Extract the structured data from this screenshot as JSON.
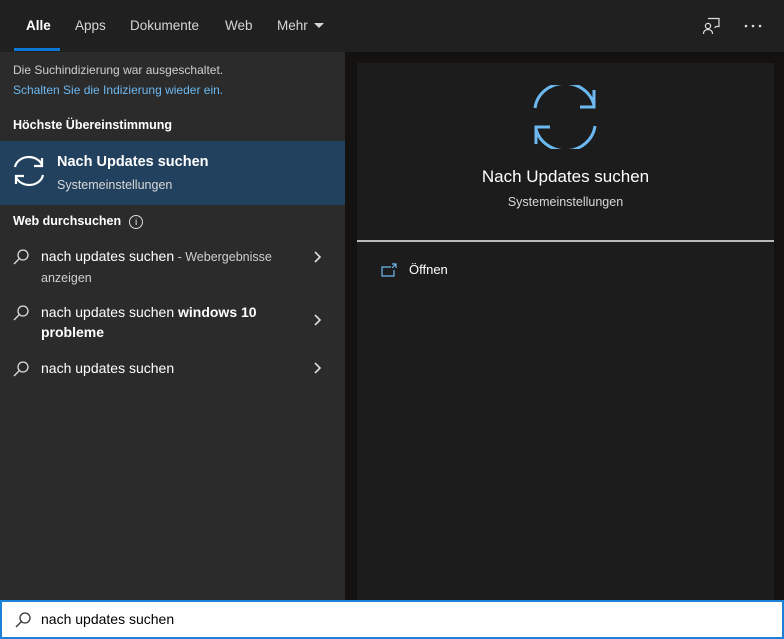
{
  "tabs": [
    {
      "label": "Alle",
      "active": true
    },
    {
      "label": "Apps"
    },
    {
      "label": "Dokumente"
    },
    {
      "label": "Web"
    },
    {
      "label": "Mehr"
    }
  ],
  "header_icons": [
    "feedback-icon",
    "more-options-icon"
  ],
  "notice": {
    "text": "Die Suchindizierung war ausgeschaltet.",
    "link": "Schalten Sie die Indizierung wieder ein."
  },
  "best_match": {
    "heading": "Höchste Übereinstimmung",
    "title": "Nach Updates suchen",
    "subtitle": "Systemeinstellungen",
    "icon": "sync-icon"
  },
  "web": {
    "heading": "Web durchsuchen",
    "items": [
      {
        "query": "nach updates suchen",
        "suffix": " - Webergebnisse anzeigen"
      },
      {
        "query": "nach updates suchen ",
        "bold": "windows 10 probleme"
      },
      {
        "query": "nach updates suchen"
      }
    ]
  },
  "preview": {
    "title": "Nach Updates suchen",
    "subtitle": "Systemeinstellungen",
    "actions": [
      {
        "label": "Öffnen",
        "icon": "open-icon"
      }
    ]
  },
  "search": {
    "value": "nach updates suchen"
  },
  "colors": {
    "accent": "#0a78d4",
    "selection": "#22415f",
    "link": "#6cb8f0",
    "icon_blue": "#6cb8f0"
  }
}
